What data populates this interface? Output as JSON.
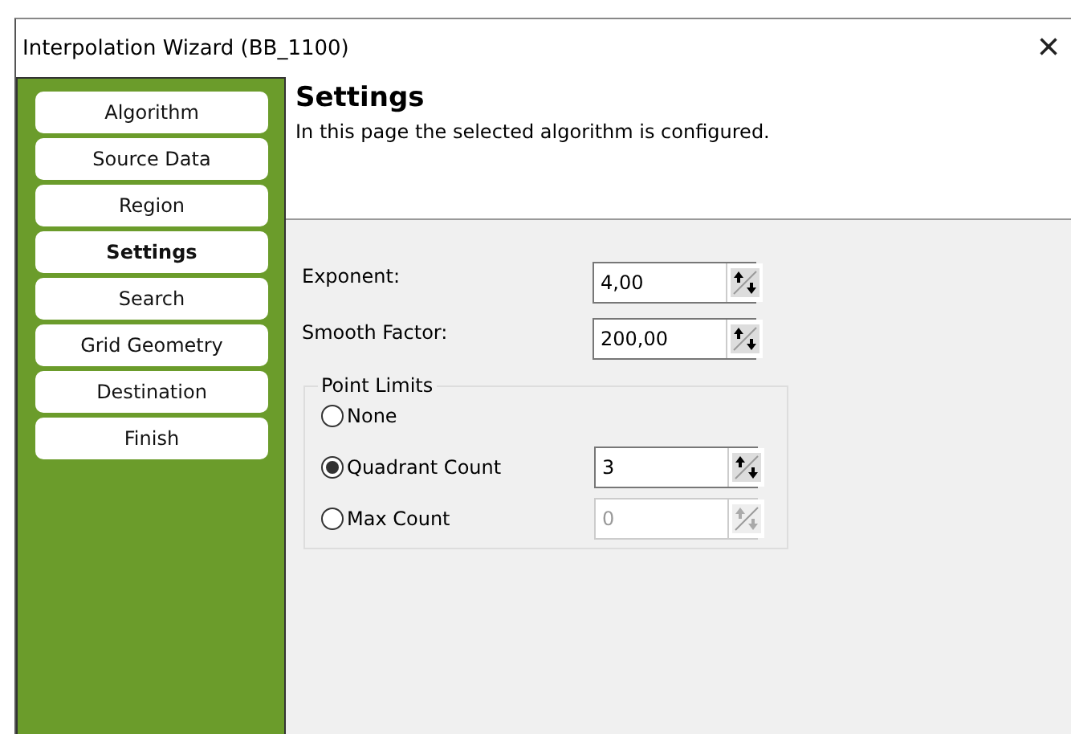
{
  "window": {
    "title": "Interpolation Wizard (BB_1100)",
    "close": "×"
  },
  "steps": [
    {
      "label": "Algorithm",
      "selected": false
    },
    {
      "label": "Source Data",
      "selected": false
    },
    {
      "label": "Region",
      "selected": false
    },
    {
      "label": "Settings",
      "selected": true
    },
    {
      "label": "Search",
      "selected": false
    },
    {
      "label": "Grid Geometry",
      "selected": false
    },
    {
      "label": "Destination",
      "selected": false
    },
    {
      "label": "Finish",
      "selected": false
    }
  ],
  "header": {
    "title": "Settings",
    "description": "In this page the selected algorithm is configured."
  },
  "fields": [
    {
      "label": "Exponent:",
      "value": "4,00"
    },
    {
      "label": "Smooth Factor:",
      "value": "200,00"
    }
  ],
  "point_limits": {
    "title": "Point Limits",
    "options": [
      {
        "label": "None",
        "selected": false
      },
      {
        "label": "Quadrant Count",
        "selected": true,
        "value": "3",
        "disabled": false
      },
      {
        "label": "Max Count",
        "selected": false,
        "value": "0",
        "disabled": true
      }
    ]
  }
}
